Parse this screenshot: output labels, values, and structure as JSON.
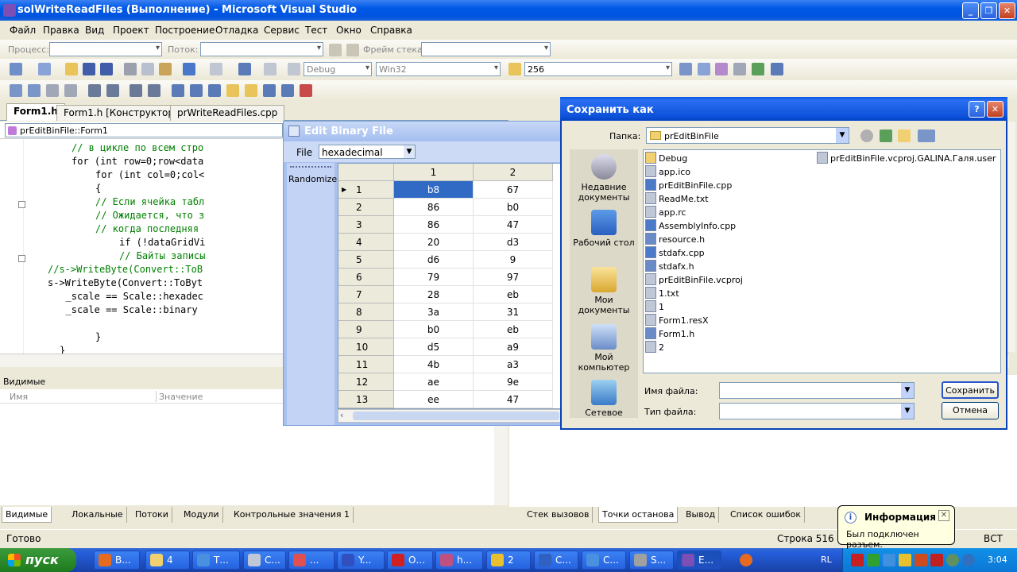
{
  "vs": {
    "title": "solWriteReadFiles (Выполнение) - Microsoft Visual Studio",
    "menu": [
      "Файл",
      "Правка",
      "Вид",
      "Проект",
      "Построение",
      "Отладка",
      "Сервис",
      "Тест",
      "Окно",
      "Справка"
    ],
    "debug_bar": {
      "process_label": "Процесс:",
      "thread_label": "Поток:",
      "frame_label": "Фрейм стека:"
    },
    "toolbar": {
      "config": "Debug",
      "platform": "Win32",
      "find_value": "256"
    },
    "tabs": [
      "Form1.h",
      "Form1.h [Конструктор]",
      "prWriteReadFiles.cpp"
    ],
    "nav_scope": "prEditBinFile::Form1",
    "code_lines": [
      {
        "indent": "        ",
        "text": "// в цикле по всем стро",
        "kind": "cm"
      },
      {
        "indent": "        ",
        "text": "for (int row=0;row<data",
        "kind": "kw"
      },
      {
        "indent": "            ",
        "text": "for (int col=0;col<",
        "kind": "kw"
      },
      {
        "indent": "            ",
        "text": "{",
        "kind": "plain"
      },
      {
        "indent": "            ",
        "text": "// Если ячейка табл",
        "kind": "cm"
      },
      {
        "indent": "            ",
        "text": "// Ожидается, что з",
        "kind": "cm"
      },
      {
        "indent": "            ",
        "text": "// когда последняя",
        "kind": "cm"
      },
      {
        "indent": "                ",
        "text": "if (!dataGridVi",
        "kind": "kw"
      },
      {
        "indent": "                ",
        "text": "// Байты записы",
        "kind": "cm"
      },
      {
        "indent": "    ",
        "text": "//s->WriteByte(Convert::ToB",
        "kind": "cm"
      },
      {
        "indent": "    ",
        "text": "s->WriteByte(Convert::ToByt",
        "kind": "plain"
      },
      {
        "indent": "       ",
        "text": "_scale == Scale::hexadec",
        "kind": "plain"
      },
      {
        "indent": "       ",
        "text": "_scale == Scale::binary",
        "kind": "plain"
      },
      {
        "indent": "",
        "text": "",
        "kind": "plain"
      },
      {
        "indent": "            ",
        "text": "}",
        "kind": "plain"
      },
      {
        "indent": "      ",
        "text": "}",
        "kind": "plain"
      }
    ],
    "watch": {
      "title": "Видимые",
      "col_name": "Имя",
      "col_value": "Значение"
    },
    "bottom_tabs_left": [
      "Видимые",
      "Локальные",
      "Потоки",
      "Модули",
      "Контрольные значения 1"
    ],
    "bottom_tabs_right": [
      "Стек вызовов",
      "Точки останова",
      "Вывод",
      "Список ошибок"
    ],
    "status": {
      "left": "Готово",
      "line": "Строка 516",
      "mode": "ВСТ"
    }
  },
  "edit_binary": {
    "title": "Edit Binary File",
    "menu_file": "File",
    "scale": "hexadecimal",
    "randomize_label": "Randomize",
    "columns": [
      "1",
      "2"
    ],
    "rows": [
      {
        "n": "1",
        "c1": "b8",
        "c2": "67"
      },
      {
        "n": "2",
        "c1": "86",
        "c2": "b0"
      },
      {
        "n": "3",
        "c1": "86",
        "c2": "47"
      },
      {
        "n": "4",
        "c1": "20",
        "c2": "d3"
      },
      {
        "n": "5",
        "c1": "d6",
        "c2": "9"
      },
      {
        "n": "6",
        "c1": "79",
        "c2": "97"
      },
      {
        "n": "7",
        "c1": "28",
        "c2": "eb"
      },
      {
        "n": "8",
        "c1": "3a",
        "c2": "31"
      },
      {
        "n": "9",
        "c1": "b0",
        "c2": "eb"
      },
      {
        "n": "10",
        "c1": "d5",
        "c2": "a9"
      },
      {
        "n": "11",
        "c1": "4b",
        "c2": "a3"
      },
      {
        "n": "12",
        "c1": "ae",
        "c2": "9e"
      },
      {
        "n": "13",
        "c1": "ee",
        "c2": "47"
      }
    ]
  },
  "save_dialog": {
    "title": "Сохранить как",
    "folder_label": "Папка:",
    "folder": "prEditBinFile",
    "places": [
      "Недавние документы",
      "Рабочий стол",
      "Мои документы",
      "Мой компьютер",
      "Сетевое"
    ],
    "files_col1": [
      "Debug",
      "app.ico",
      "prEditBinFile.cpp",
      "ReadMe.txt",
      "app.rc",
      "AssemblyInfo.cpp",
      "resource.h",
      "stdafx.cpp",
      "stdafx.h",
      "prEditBinFile.vcproj",
      "1.txt",
      "1",
      "Form1.resX",
      "Form1.h",
      "2"
    ],
    "files_col2": [
      "prEditBinFile.vcproj.GALINA.Галя.user"
    ],
    "filename_label": "Имя файла:",
    "filetype_label": "Тип файла:",
    "save_btn": "Сохранить",
    "cancel_btn": "Отмена"
  },
  "balloon": {
    "title": "Информация",
    "text": "Был подключен разъем."
  },
  "taskbar": {
    "start": "пуск",
    "tasks": [
      "В...",
      "4",
      "Т...",
      "С...",
      "...",
      "Y...",
      "О...",
      "h...",
      "2",
      "С...",
      "С...",
      "S...",
      "Е..."
    ],
    "lang": "RL",
    "clock": "3:04"
  }
}
